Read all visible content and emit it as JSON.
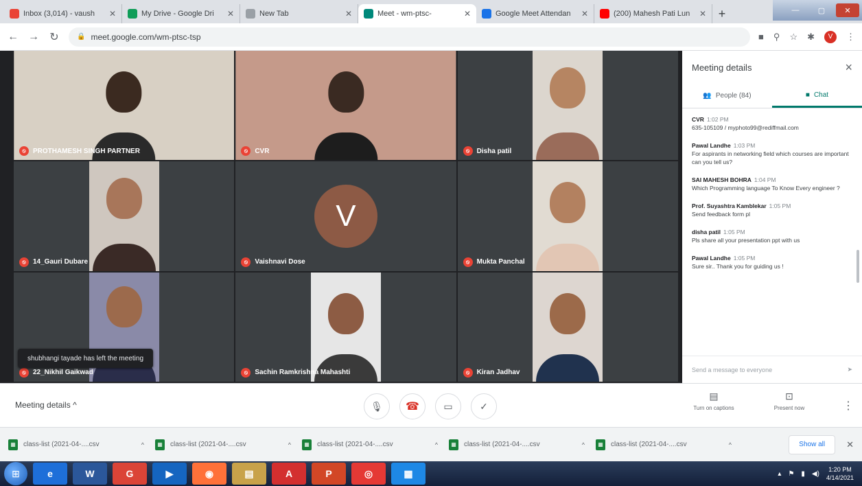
{
  "browser": {
    "tabs": [
      {
        "label": "Inbox (3,014) - vaush",
        "favicon_color": "#ea4335"
      },
      {
        "label": "My Drive - Google Dri",
        "favicon_color": "#0f9d58"
      },
      {
        "label": "New Tab",
        "favicon_color": "#9aa0a6"
      },
      {
        "label": "Meet - wm-ptsc-",
        "favicon_color": "#00897b"
      },
      {
        "label": "Google Meet Attendan",
        "favicon_color": "#1a73e8"
      },
      {
        "label": "(200) Mahesh Pati Lun",
        "favicon_color": "#ff0000"
      }
    ],
    "new_tab_symbol": "+",
    "url": "meet.google.com/wm-ptsc-tsp",
    "profile_initial": "V"
  },
  "tiles": [
    {
      "name": "PROTHAMESH SINGH PARTNER",
      "bg": "#d8d0c4",
      "head": "#3b2a20",
      "body": "#2a2a2a",
      "kind": "video"
    },
    {
      "name": "CVR",
      "bg": "#c59a8a",
      "head": "#3a2a22",
      "body": "#1d1d1d",
      "kind": "video"
    },
    {
      "name": "Disha patil",
      "bg": "#dcd6ce",
      "head": "#b68562",
      "body": "#9a6c5a",
      "kind": "video"
    },
    {
      "name": "14_Gauri Dubare",
      "bg": "#cfc7bf",
      "head": "#a8765a",
      "body": "#3a2a26",
      "kind": "video"
    },
    {
      "name": "Vaishnavi Dose",
      "kind": "avatar",
      "initial": "V"
    },
    {
      "name": "Mukta Panchal",
      "bg": "#e1dbd2",
      "head": "#b38160",
      "body": "#e2c6b4",
      "kind": "video"
    },
    {
      "name": "22_Nikhil Gaikwad",
      "bg": "#8a8aa8",
      "head": "#9c6a4c",
      "body": "#2a2d4a",
      "kind": "video"
    },
    {
      "name": "Sachin Ramkrishna Mahashti",
      "bg": "#e6e6e6",
      "head": "#8d5c44",
      "body": "#3a3a3a",
      "kind": "video"
    },
    {
      "name": "Kiran Jadhav",
      "bg": "#ddd6d0",
      "head": "#9c6a4a",
      "body": "#20324e",
      "kind": "video"
    }
  ],
  "toast": "shubhangi tayade has left the meeting",
  "panel": {
    "title": "Meeting details",
    "close_symbol": "×",
    "tab_people": "People (84)",
    "tab_chat": "Chat",
    "messages": [
      {
        "who": "CVR",
        "when": "1:02 PM",
        "text": "635-105109 / myphoto99@rediffmail.com"
      },
      {
        "who": "Pawal Landhe",
        "when": "1:03 PM",
        "text": "For aspirants in networking field which courses are important can you tell us?"
      },
      {
        "who": "SAI MAHESH BOHRA",
        "when": "1:04 PM",
        "text": "Which Programming language To Know Every engineer ?"
      },
      {
        "who": "Prof. Suyashtra Kamblekar",
        "when": "1:05 PM",
        "text": "Send feedback form pl"
      },
      {
        "who": "disha patil",
        "when": "1:05 PM",
        "text": "Pls share all your presentation ppt with us"
      },
      {
        "who": "Pawal Landhe",
        "when": "1:05 PM",
        "text": "Sure sir.. Thank you for guiding us !"
      }
    ],
    "input_placeholder": "Send a message to everyone"
  },
  "controls": {
    "meeting_details": "Meeting details",
    "mic": "🎙",
    "hangup": "☎",
    "camera": "▭",
    "check": "✓",
    "captions": "Turn on captions",
    "present": "Present now"
  },
  "downloads": [
    {
      "name": "class-list (2021-04-....csv"
    },
    {
      "name": "class-list (2021-04-....csv"
    },
    {
      "name": "class-list (2021-04-....csv"
    },
    {
      "name": "class-list (2021-04-....csv"
    },
    {
      "name": "class-list (2021-04-....csv"
    }
  ],
  "show_all": "Show all",
  "taskbar": {
    "apps": [
      {
        "glyph": "e",
        "color": "#1e6fd9"
      },
      {
        "glyph": "W",
        "color": "#2b579a"
      },
      {
        "glyph": "G",
        "color": "#db4437"
      },
      {
        "glyph": "▶",
        "color": "#1565c0"
      },
      {
        "glyph": "◉",
        "color": "#ff7139"
      },
      {
        "glyph": "▤",
        "color": "#c8a24a"
      },
      {
        "glyph": "A",
        "color": "#d32f2f"
      },
      {
        "glyph": "P",
        "color": "#d24726"
      },
      {
        "glyph": "◎",
        "color": "#e53935"
      },
      {
        "glyph": "▦",
        "color": "#1e88e5"
      }
    ],
    "time": "1:20 PM",
    "date": "4/14/2021"
  }
}
